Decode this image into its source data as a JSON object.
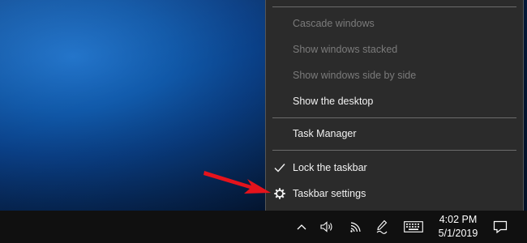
{
  "context_menu": {
    "items": [
      {
        "label": "Cascade windows",
        "enabled": false
      },
      {
        "label": "Show windows stacked",
        "enabled": false
      },
      {
        "label": "Show windows side by side",
        "enabled": false
      },
      {
        "label": "Show the desktop",
        "enabled": true
      },
      {
        "label": "Task Manager",
        "enabled": true
      },
      {
        "label": "Lock the taskbar",
        "enabled": true,
        "checked": true,
        "icon": "check-icon"
      },
      {
        "label": "Taskbar settings",
        "enabled": true,
        "icon": "gear-icon"
      }
    ]
  },
  "taskbar": {
    "clock": {
      "time": "4:02 PM",
      "date": "5/1/2019"
    },
    "tray_icons": [
      "chevron-up-icon",
      "volume-icon",
      "wifi-icon",
      "pen-icon",
      "keyboard-icon",
      "notification-icon"
    ]
  },
  "annotation": {
    "color": "#e5131c",
    "points_to": "Taskbar settings"
  },
  "colors": {
    "menu_bg": "#2b2b2b",
    "menu_text": "#f2f2f2",
    "menu_disabled": "#7b7b7b",
    "taskbar_bg": "#101010"
  }
}
